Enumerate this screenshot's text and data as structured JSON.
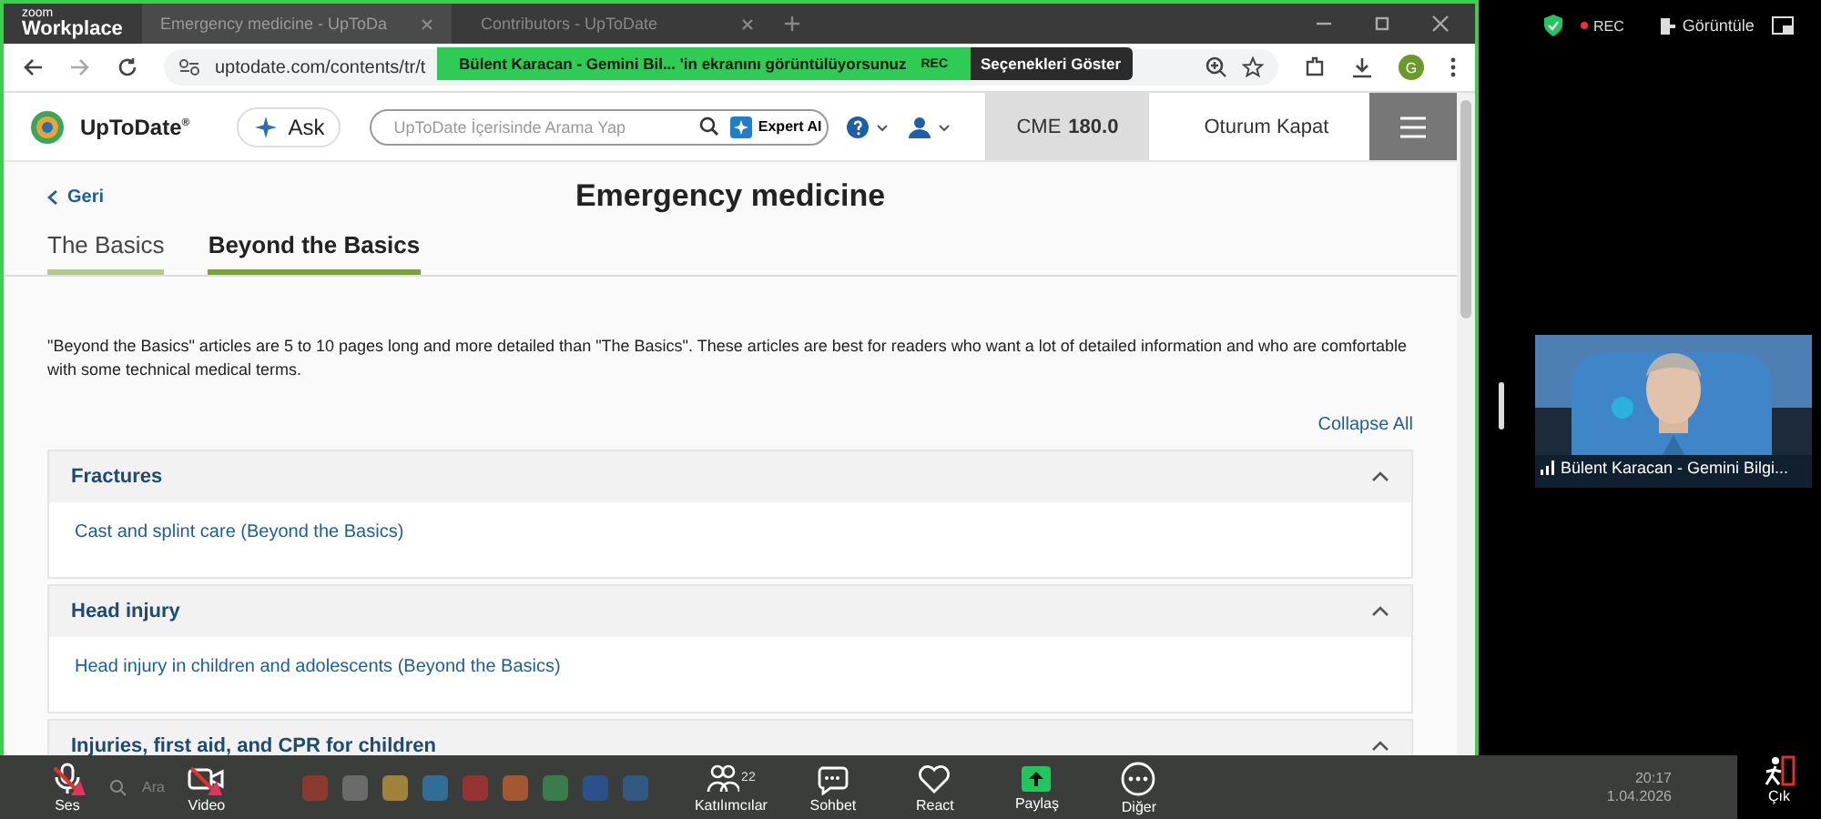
{
  "zoom_logo": {
    "small": "zoom",
    "large": "Workplace"
  },
  "browser": {
    "tabs": [
      {
        "title": "Emergency medicine - UpToDa",
        "selected": true
      },
      {
        "title": "Contributors - UpToDate",
        "selected": false
      }
    ],
    "url": "uptodate.com/contents/tr/t",
    "profile_initial": "G"
  },
  "share_banner": {
    "text": "Bülent Karacan - Gemini Bil... 'in ekranını görüntülüyorsunuz",
    "rec": "REC",
    "options": "Seçenekleri Göster"
  },
  "header": {
    "brand": "UpToDate",
    "brand_mark": "®",
    "ask": "Ask",
    "search_placeholder": "UpToDate İçerisinde Arama Yap",
    "expert": "Expert AI",
    "cme_label": "CME",
    "cme_value": "180.0",
    "logout": "Oturum Kapat"
  },
  "page": {
    "back": "Geri",
    "title": "Emergency medicine",
    "tabs": [
      {
        "label": "The Basics",
        "selected": false
      },
      {
        "label": "Beyond the Basics",
        "selected": true
      }
    ],
    "intro": "\"Beyond the Basics\" articles are 5 to 10 pages long and more detailed than \"The Basics\". These articles are best for readers who want a lot of detailed information and who are comfortable with some technical medical terms.",
    "collapse_all": "Collapse All",
    "sections": [
      {
        "title": "Fractures",
        "expanded": true,
        "links": [
          "Cast and splint care (Beyond the Basics)"
        ]
      },
      {
        "title": "Head injury",
        "expanded": true,
        "links": [
          "Head injury in children and adolescents (Beyond the Basics)"
        ]
      },
      {
        "title": "Injuries, first aid, and CPR for children",
        "expanded": true
      }
    ]
  },
  "meeting": {
    "rec": "REC",
    "view": "Görüntüle",
    "participant": "Bülent Karacan - Gemini Bilgi...",
    "audio_muted": true,
    "video_muted": true,
    "toolbar": [
      {
        "label": "Ses",
        "kind": "mic"
      },
      {
        "label": "Video",
        "kind": "camera"
      },
      {
        "label": "Katılımcılar",
        "kind": "people",
        "count": "22"
      },
      {
        "label": "Sohbet",
        "kind": "chat"
      },
      {
        "label": "React",
        "kind": "heart"
      },
      {
        "label": "Paylaş",
        "kind": "share"
      },
      {
        "label": "Diğer",
        "kind": "more"
      }
    ],
    "leave": "Çık"
  },
  "taskbar": {
    "search": "Ara",
    "time": "20:17",
    "date": "1.04.2026"
  }
}
